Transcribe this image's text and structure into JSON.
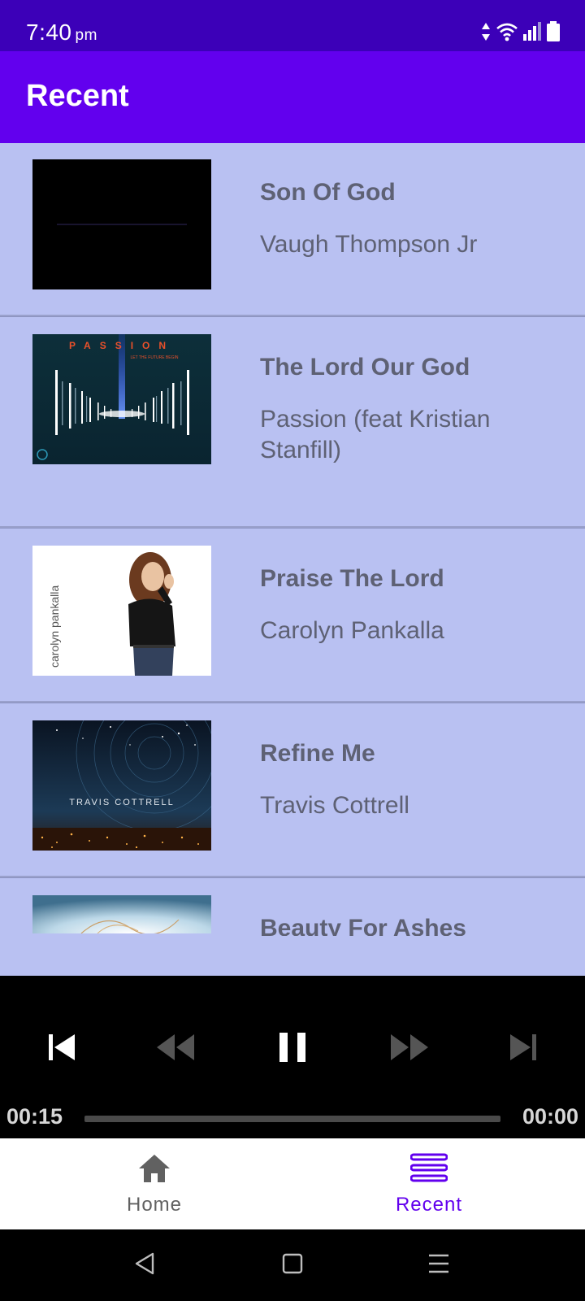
{
  "status_bar": {
    "time": "7:40",
    "ampm": "pm",
    "icons": [
      "data-arrows-icon",
      "wifi-icon",
      "signal-icon",
      "battery-icon"
    ]
  },
  "app_bar": {
    "title": "Recent"
  },
  "songs": [
    {
      "title": "Son Of God",
      "artist": "Vaugh Thompson Jr",
      "art": "waveform-art"
    },
    {
      "title": "The Lord Our God",
      "artist": "Passion (feat Kristian Stanfill)",
      "art": "passion-art",
      "art_text": "PASSION",
      "art_subtext": "LET THE FUTURE BEGIN"
    },
    {
      "title": "Praise The Lord",
      "artist": "Carolyn Pankalla",
      "art": "portrait-art",
      "art_text": "carolyn pankalla"
    },
    {
      "title": "Refine Me",
      "artist": "Travis Cottrell",
      "art": "night-sky-art",
      "art_text": "TRAVIS COTTRELL"
    },
    {
      "title": "Beauty For Ashes",
      "artist": "",
      "art": "abstract-art"
    }
  ],
  "player": {
    "elapsed": "00:15",
    "duration": "00:00",
    "progress_fraction": 0,
    "controls": [
      "skip-previous",
      "rewind",
      "pause",
      "fast-forward",
      "skip-next"
    ]
  },
  "bottom_nav": {
    "items": [
      {
        "label": "Home",
        "icon": "home-icon",
        "active": false
      },
      {
        "label": "Recent",
        "icon": "recent-list-icon",
        "active": true
      }
    ],
    "active_color": "#6200ee",
    "inactive_color": "#616161"
  },
  "colors": {
    "status_bar": "#3c00b8",
    "app_bar": "#6200ee",
    "card_bg": "#b9c1f2",
    "text_secondary": "#5e6174"
  }
}
